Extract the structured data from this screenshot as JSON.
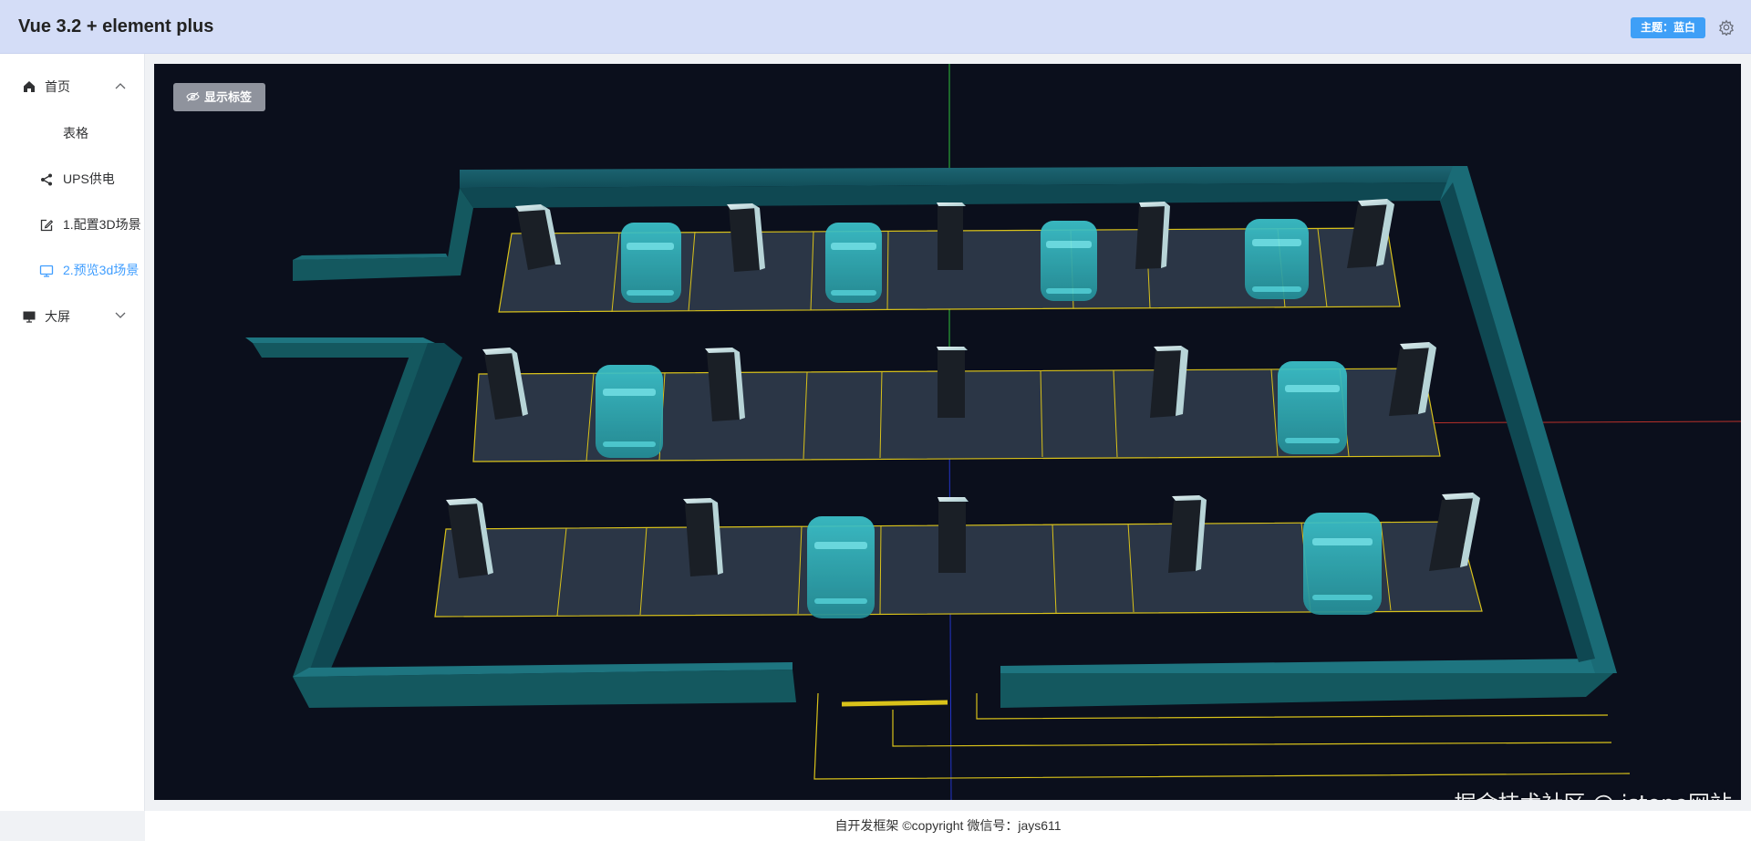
{
  "header": {
    "title": "Vue 3.2 + element plus",
    "theme_badge": "主题：蓝白",
    "settings_icon": "gear-icon"
  },
  "sidebar": {
    "items": [
      {
        "label": "首页",
        "icon": "home-icon",
        "expanded": true
      },
      {
        "label": "表格",
        "icon": ""
      },
      {
        "label": "UPS供电",
        "icon": "share-icon"
      },
      {
        "label": "1.配置3D场景",
        "icon": "edit-icon"
      },
      {
        "label": "2.预览3d场景",
        "icon": "monitor-icon",
        "active": true
      },
      {
        "label": "大屏",
        "icon": "screen-icon",
        "expanded": false
      }
    ]
  },
  "viewport": {
    "show_labels_button": "显示标签",
    "show_labels_icon": "eye-off-icon",
    "watermark": "掘金技术社区 @ jstopo网站"
  },
  "footer": {
    "text": "自开发框架 ©copyright 微信号：jays611"
  },
  "colors": {
    "accent": "#409eff",
    "header_bg": "#d4ddf7",
    "scene_bg": "#0b0f1c",
    "wall": "#13535f",
    "car": "#2fb4bd",
    "slot_line": "#d9c21a"
  }
}
